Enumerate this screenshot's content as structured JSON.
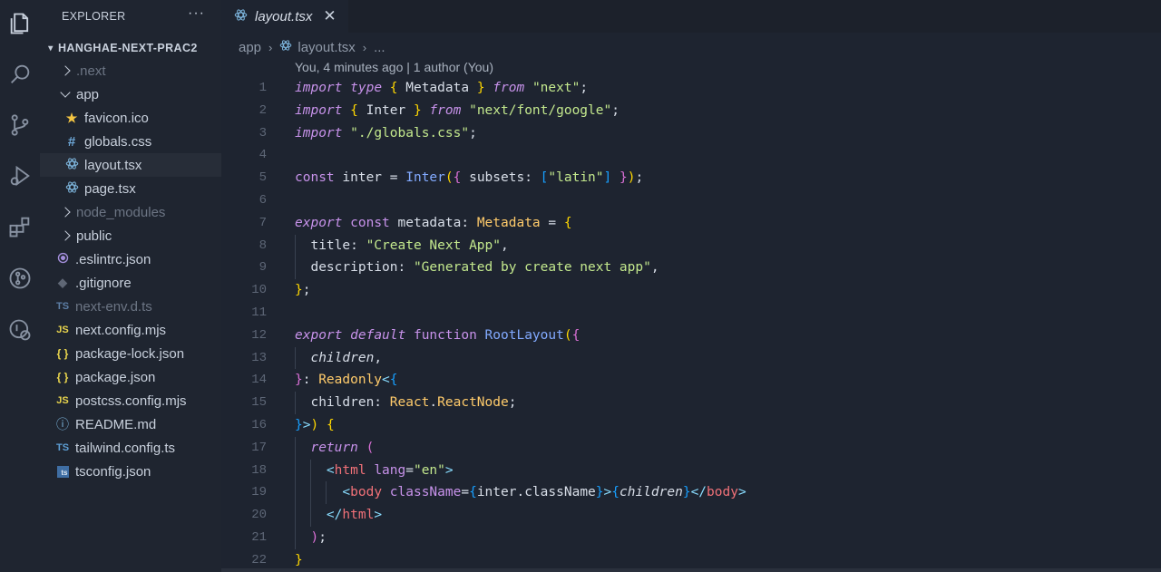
{
  "sidebar": {
    "header": "EXPLORER",
    "more": "···",
    "root": "HANGHAE-NEXT-PRAC2",
    "items": [
      {
        "label": ".next",
        "icon": "chevron-right",
        "dim": true
      },
      {
        "label": "app",
        "icon": "chevron-down"
      },
      {
        "label": "favicon.ico",
        "icon": "star-icon",
        "glyph": "★"
      },
      {
        "label": "globals.css",
        "icon": "hash-icon",
        "glyph": "#"
      },
      {
        "label": "layout.tsx",
        "icon": "react-icon",
        "selected": true
      },
      {
        "label": "page.tsx",
        "icon": "react-icon"
      },
      {
        "label": "node_modules",
        "icon": "chevron-right",
        "dim": true
      },
      {
        "label": "public",
        "icon": "chevron-right"
      },
      {
        "label": ".eslintrc.json",
        "icon": "eslint-icon"
      },
      {
        "label": ".gitignore",
        "icon": "git-icon"
      },
      {
        "label": "next-env.d.ts",
        "icon": "ts-icon",
        "glyph": "TS",
        "dim": true
      },
      {
        "label": "next.config.mjs",
        "icon": "js-icon",
        "glyph": "JS"
      },
      {
        "label": "package-lock.json",
        "icon": "json-icon",
        "glyph": "{ }"
      },
      {
        "label": "package.json",
        "icon": "json-icon",
        "glyph": "{ }"
      },
      {
        "label": "postcss.config.mjs",
        "icon": "js-icon",
        "glyph": "JS"
      },
      {
        "label": "README.md",
        "icon": "info-icon",
        "glyph": "ⓘ"
      },
      {
        "label": "tailwind.config.ts",
        "icon": "ts-icon",
        "glyph": "TS"
      },
      {
        "label": "tsconfig.json",
        "icon": "tsconfig-icon",
        "glyph": "ts"
      }
    ]
  },
  "editor": {
    "tab": {
      "label": "layout.tsx",
      "close": "✕"
    },
    "breadcrumbs": [
      "app",
      "layout.tsx",
      "..."
    ],
    "blame": "You, 4 minutes ago | 1 author (You)",
    "line_numbers": [
      "1",
      "2",
      "3",
      "4",
      "5",
      "6",
      "7",
      "8",
      "9",
      "10",
      "11",
      "12",
      "13",
      "14",
      "15",
      "16",
      "17",
      "18",
      "19",
      "20",
      "21",
      "22"
    ]
  },
  "colors": {
    "background": "#1e2430",
    "keyword": "#c792ea",
    "string": "#c3e88d",
    "function": "#82aaff",
    "type": "#ffcb6b",
    "tag": "#f07178"
  }
}
